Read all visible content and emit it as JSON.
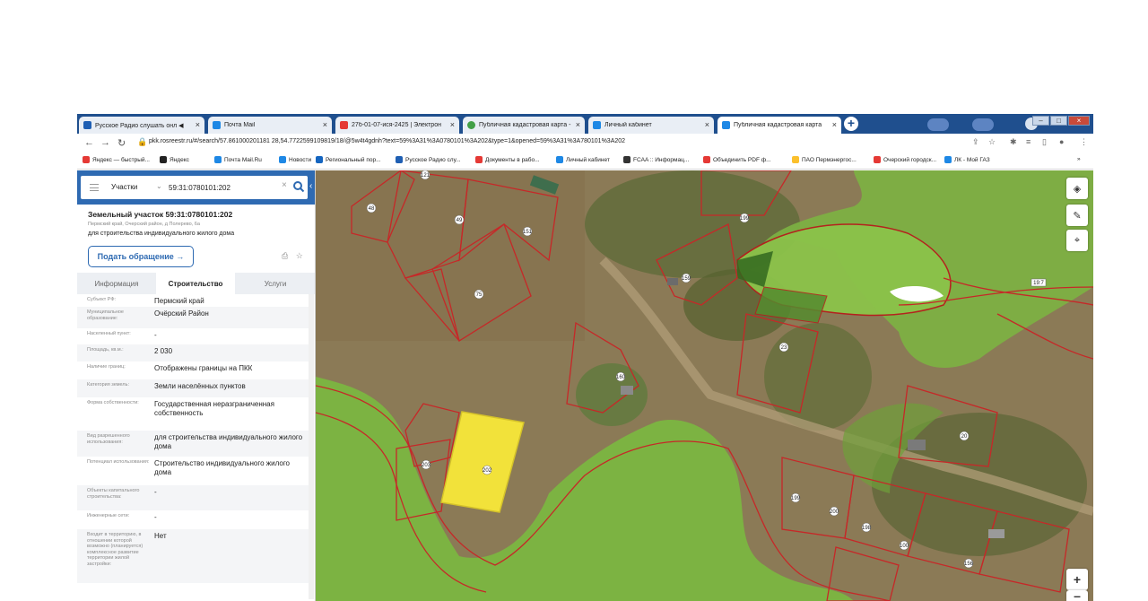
{
  "browser": {
    "tabs": [
      {
        "title": "Русское Радио слушать онл ◀",
        "active": false,
        "color": "#1f5fb3"
      },
      {
        "title": "Почта Mail",
        "active": false,
        "color": "#1e88e5"
      },
      {
        "title": "27б-01-07-ися-2425 | Электрон",
        "active": false,
        "color": "#e53935"
      },
      {
        "title": "Публичная кадастровая карта -",
        "active": false,
        "color": "#43a047"
      },
      {
        "title": "Личный кабинет",
        "active": false,
        "color": "#1e88e5"
      },
      {
        "title": "Публичная кадастровая карта",
        "active": true,
        "color": "#1e88e5"
      }
    ],
    "url": "pkk.rosreestr.ru/#/search/57.861000201181 28,54.7722599109819/18/@5w4t4gdnh?text=59%3A31%3A0780101%3A202&type=1&opened=59%3A31%3A780101%3A202",
    "bookmarks": [
      {
        "label": "Яндекс — быстрый...",
        "color": "#e53935"
      },
      {
        "label": "Яндекс",
        "color": "#222"
      },
      {
        "label": "Почта Mail.Ru",
        "color": "#1e88e5"
      },
      {
        "label": "Новости",
        "color": "#1e88e5"
      },
      {
        "label": "Региональный пор...",
        "color": "#1565c0"
      },
      {
        "label": "Русское Радио слу...",
        "color": "#1f5fb3"
      },
      {
        "label": "Документы в рабо...",
        "color": "#e53935"
      },
      {
        "label": "Личный кабинет",
        "color": "#1e88e5"
      },
      {
        "label": "FCAA :: Информац...",
        "color": "#333"
      },
      {
        "label": "Объединить PDF ф...",
        "color": "#e53935"
      },
      {
        "label": "ПАО Пермэнергос...",
        "color": "#fbc02d"
      },
      {
        "label": "Очерский городск...",
        "color": "#e53935"
      },
      {
        "label": "ЛК - Мой ГАЗ",
        "color": "#1e88e5"
      }
    ],
    "bookmarks_more": "»"
  },
  "panel": {
    "search_type": "Участки",
    "search_value": "59:31:0780101:202",
    "object_title": "Земельный участок 59:31:0780101:202",
    "object_address": "Пермский край, Очерский район, д Полерево, 6а",
    "object_purpose": "для строительства индивидуального жилого дома",
    "apply_button": "Подать обращение →",
    "tabs": [
      "Информация",
      "Строительство",
      "Услуги"
    ],
    "active_tab": "Строительство",
    "attributes": [
      {
        "key": "Субъект РФ:",
        "value": "Пермский край"
      },
      {
        "key": "Муниципальное образование:",
        "value": "Очёрский Район"
      },
      {
        "key": "Населенный пункт:",
        "value": "-"
      },
      {
        "key": "Площадь, кв.м.:",
        "value": "2 030"
      },
      {
        "key": "Наличие границ:",
        "value": "Отображены границы на ПКК"
      },
      {
        "key": "Категория земель:",
        "value": "Земли населённых пунктов"
      },
      {
        "key": "Форма собственности:",
        "value": "Государственная неразграниченная собственность"
      },
      {
        "key": "Вид разрешенного использования:",
        "value": "для строительства индивидуального жилого дома"
      },
      {
        "key": "Потенциал использования:",
        "value": "Строительство индивидуального жилого дома"
      },
      {
        "key": "Объекты капитального строительства:",
        "value": "-"
      },
      {
        "key": "Инженерные сети:",
        "value": "-"
      },
      {
        "key": "Входит в территорию, в отношении которой возможно (планируется) комплексное развитие территории жилой застройки:",
        "value": "Нет"
      }
    ]
  },
  "map": {
    "parcel_labels": [
      "48",
      "121",
      "49",
      "151",
      "75",
      "199",
      "159",
      "160",
      "23",
      "20",
      "203",
      "202",
      "199",
      "200",
      "198",
      "100",
      "156",
      "19:7"
    ],
    "colors": {
      "zone_green": "#7cb342",
      "zone_light": "#8bc34a",
      "parcel_border": "#c62828",
      "selected": "#f2e23a"
    },
    "controls": [
      "layers-icon",
      "ruler-icon",
      "locate-icon",
      "zoom-in-icon",
      "zoom-out-icon"
    ]
  }
}
